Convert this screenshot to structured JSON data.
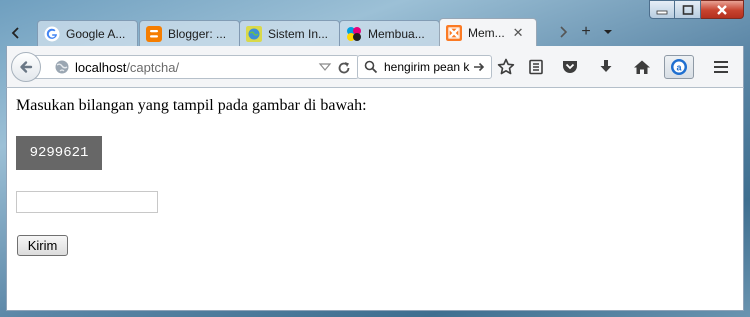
{
  "tabs": [
    {
      "title": "Google A...",
      "favicon": "google-favicon",
      "active": false
    },
    {
      "title": "Blogger: ...",
      "favicon": "blogger-favicon",
      "active": false
    },
    {
      "title": "Sistem In...",
      "favicon": "globe-favicon",
      "active": false
    },
    {
      "title": "Membua...",
      "favicon": "colorful-favicon",
      "active": false
    },
    {
      "title": "Mem...",
      "favicon": "xampp-favicon",
      "active": true
    }
  ],
  "tab_close_glyph": "✕",
  "new_tab_glyph": "+",
  "address": {
    "host": "localhost",
    "path": "/captcha/"
  },
  "search": {
    "value": "hengirim pean k"
  },
  "page": {
    "instruction": "Masukan bilangan yang tampil pada gambar di bawah:",
    "captcha_code": "9299621",
    "answer_value": "",
    "submit_label": "Kirim"
  },
  "colors": {
    "captcha_bg": "#676767",
    "captcha_text": "#ffffff",
    "firefox_chrome": "#f4f5f7"
  }
}
